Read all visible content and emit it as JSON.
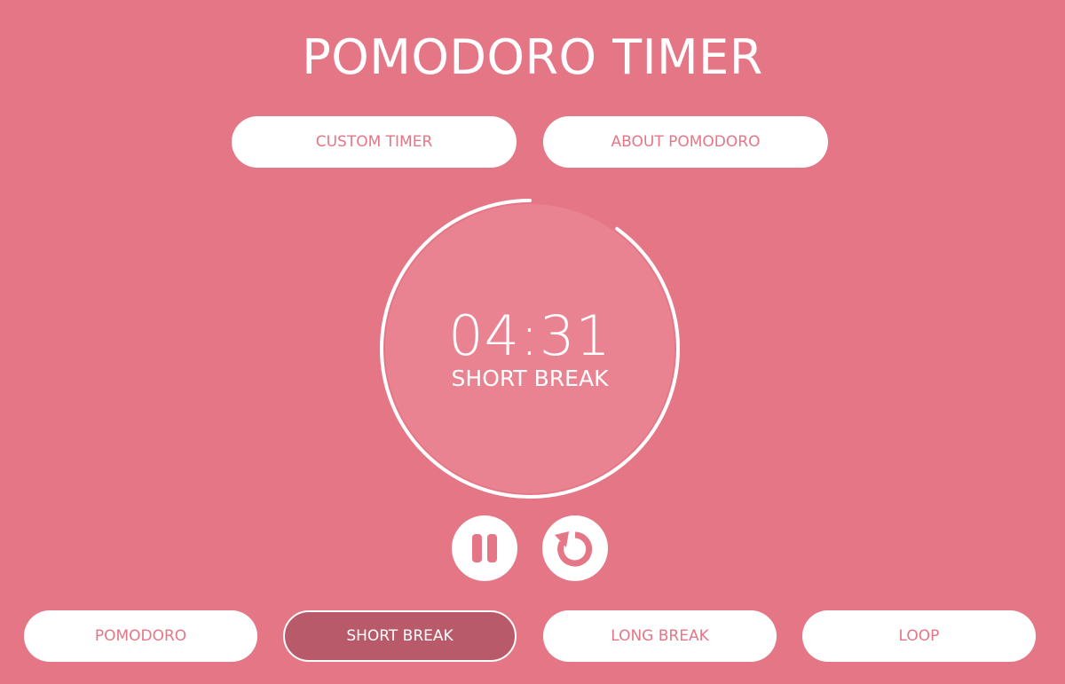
{
  "app": {
    "title": "POMODORO TIMER"
  },
  "top_buttons": {
    "custom_timer": "CUSTOM TIMER",
    "about": "ABOUT POMODORO"
  },
  "timer": {
    "time": "04:31",
    "mode": "SHORT BREAK",
    "progress_remaining": 0.9
  },
  "controls": {
    "pause_icon": "pause-icon",
    "reset_icon": "reset-icon"
  },
  "modes": [
    {
      "label": "POMODORO",
      "active": false
    },
    {
      "label": "SHORT BREAK",
      "active": true
    },
    {
      "label": "LONG BREAK",
      "active": false
    },
    {
      "label": "LOOP",
      "active": false
    }
  ],
  "colors": {
    "background": "#e57686",
    "circle_fill": "#e98392",
    "active_button": "#b95a6a",
    "white": "#ffffff"
  }
}
